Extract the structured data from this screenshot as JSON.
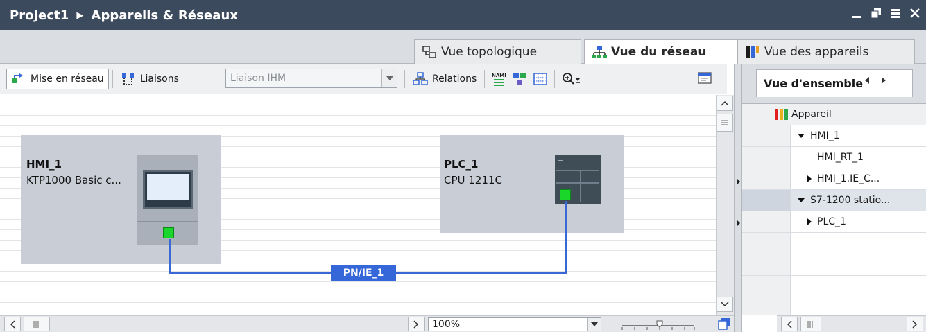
{
  "window": {
    "project": "Project1",
    "separator": "▶",
    "section": "Appareils & Réseaux",
    "minimize_icon": "minimize-icon",
    "restore_icon": "restore-icon",
    "tile_icon": "tile-icon",
    "close_icon": "close-icon"
  },
  "view_tabs": [
    {
      "label": "Vue topologique",
      "icon": "topology-icon",
      "active": false
    },
    {
      "label": "Vue du réseau",
      "icon": "network-icon",
      "active": true
    },
    {
      "label": "Vue des appareils",
      "icon": "device-icon",
      "active": false
    }
  ],
  "toolbar": {
    "network_label": "Mise en réseau",
    "links_label": "Liaisons",
    "link_combo_value": "Liaison IHM",
    "relations_label": "Relations"
  },
  "devices": [
    {
      "name": "HMI_1",
      "type": "KTP1000 Basic c..."
    },
    {
      "name": "PLC_1",
      "type": "CPU 1211C"
    }
  ],
  "network": {
    "label": "PN/IE_1",
    "color": "#3567d8"
  },
  "zoom": {
    "value": "100%"
  },
  "overview": {
    "tab_label": "Vue d'ensemble",
    "column_header": "Appareil",
    "rows": [
      {
        "label": "HMI_1",
        "indent": 1,
        "toggle": "down"
      },
      {
        "label": "HMI_RT_1",
        "indent": 2,
        "toggle": "none"
      },
      {
        "label": "HMI_1.IE_C...",
        "indent": 2,
        "toggle": "right"
      },
      {
        "label": "S7-1200 statio...",
        "indent": 1,
        "toggle": "down",
        "selected": true
      },
      {
        "label": "PLC_1",
        "indent": 2,
        "toggle": "right"
      }
    ]
  },
  "colors": {
    "title_bar": "#3c4a5e",
    "port": "#1bd62a",
    "device_bg": "#c8cdd6"
  }
}
